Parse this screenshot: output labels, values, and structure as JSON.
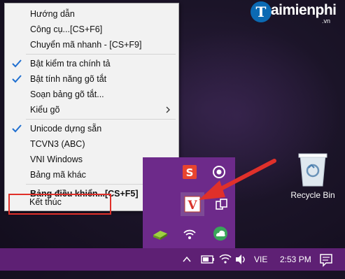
{
  "logo": {
    "badge": "T",
    "name": "aimienphi",
    "domain": ".vn"
  },
  "menu": {
    "items": [
      {
        "label": "Hướng dẫn",
        "checked": false,
        "submenu": false
      },
      {
        "label": "Công cụ...[CS+F6]",
        "checked": false,
        "submenu": false
      },
      {
        "label": "Chuyển mã nhanh - [CS+F9]",
        "checked": false,
        "submenu": false
      },
      {
        "label": "Bật kiểm tra chính tả",
        "checked": true,
        "submenu": false
      },
      {
        "label": "Bật tính năng gõ tắt",
        "checked": true,
        "submenu": false
      },
      {
        "label": "Soạn bảng gõ tắt...",
        "checked": false,
        "submenu": false
      },
      {
        "label": "Kiểu gõ",
        "checked": false,
        "submenu": true
      },
      {
        "label": "Unicode dựng sẵn",
        "checked": true,
        "submenu": false
      },
      {
        "label": "TCVN3 (ABC)",
        "checked": false,
        "submenu": false
      },
      {
        "label": "VNI Windows",
        "checked": false,
        "submenu": false
      },
      {
        "label": "Bảng mã khác",
        "checked": false,
        "submenu": true
      },
      {
        "label": "Bảng điều khiển...[CS+F5]",
        "checked": false,
        "submenu": false,
        "bold": true
      },
      {
        "label": "Kết thúc",
        "checked": false,
        "submenu": false,
        "highlighted": true
      }
    ]
  },
  "desktop": {
    "recycle_bin_label": "Recycle Bin"
  },
  "tray_popup": {
    "icons": [
      "s-app-icon",
      "record-icon",
      "vietkey-v-icon",
      "devices-icon",
      "usb-drive-icon",
      "wifi-app-icon",
      "cloud-icon"
    ]
  },
  "taskbar": {
    "language": "VIE",
    "time": "2:53 PM",
    "colors": {
      "taskbar": "#5e2074",
      "popup": "#6d2a8a",
      "highlight_box": "#e0302a",
      "check": "#1f6fd0"
    }
  }
}
